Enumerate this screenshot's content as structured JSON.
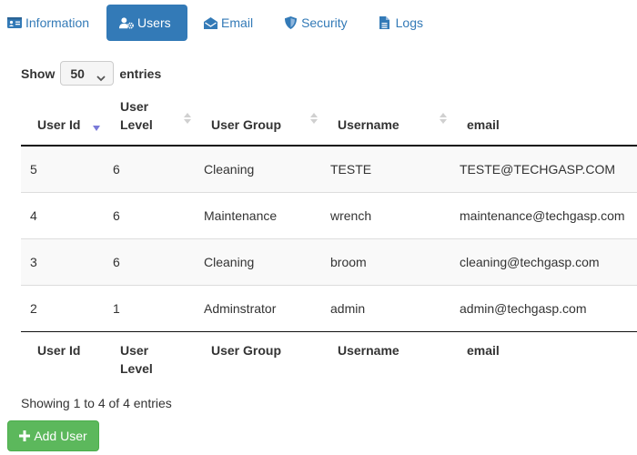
{
  "tabs": [
    {
      "label": "Information",
      "icon": "id-card-icon",
      "active": false
    },
    {
      "label": "Users",
      "icon": "users-cog-icon",
      "active": true
    },
    {
      "label": "Email",
      "icon": "envelope-open-icon",
      "active": false
    },
    {
      "label": "Security",
      "icon": "shield-icon",
      "active": false
    },
    {
      "label": "Logs",
      "icon": "file-text-icon",
      "active": false
    }
  ],
  "length_control": {
    "show_label": "Show",
    "selected": "50",
    "entries_label": "entries"
  },
  "table": {
    "columns": [
      {
        "label": "User Id",
        "sort": "desc"
      },
      {
        "label": "User Level",
        "sort": "none"
      },
      {
        "label": "User Group",
        "sort": "none"
      },
      {
        "label": "Username",
        "sort": "none"
      },
      {
        "label": "email",
        "sort": "none"
      }
    ],
    "rows": [
      {
        "id": "5",
        "level": "6",
        "group": "Cleaning",
        "username": "TESTE",
        "email": "TESTE@TECHGASP.COM"
      },
      {
        "id": "4",
        "level": "6",
        "group": "Maintenance",
        "username": "wrench",
        "email": "maintenance@techgasp.com"
      },
      {
        "id": "3",
        "level": "6",
        "group": "Cleaning",
        "username": "broom",
        "email": "cleaning@techgasp.com"
      },
      {
        "id": "2",
        "level": "1",
        "group": "Adminstrator",
        "username": "admin",
        "email": "admin@techgasp.com"
      }
    ]
  },
  "info_text": "Showing 1 to 4 of 4 entries",
  "add_button": {
    "label": "Add User",
    "icon": "plus-icon"
  },
  "colors": {
    "primary": "#337ab7",
    "success": "#5cb85c",
    "sort_active": "#7a7ad8",
    "sort_inactive": "#d0d0d0"
  }
}
